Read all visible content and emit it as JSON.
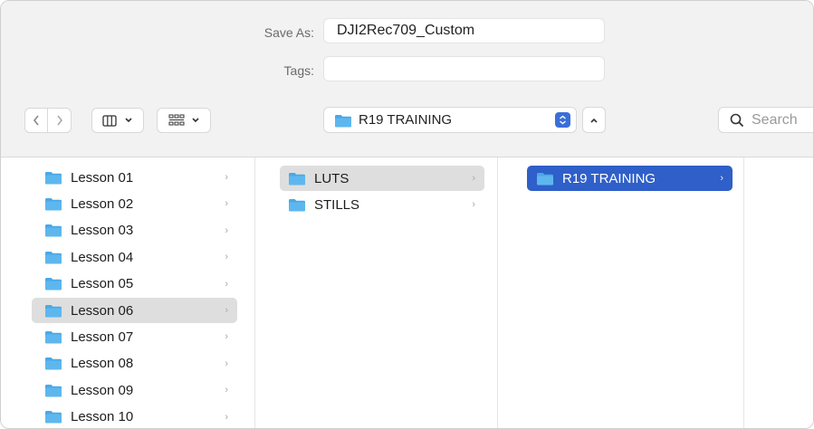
{
  "save_as": {
    "label": "Save As:",
    "value": "DJI2Rec709_Custom"
  },
  "tags": {
    "label": "Tags:",
    "value": ""
  },
  "location": {
    "name": "R19 TRAINING"
  },
  "search": {
    "placeholder": "Search"
  },
  "columns": {
    "col1": [
      {
        "label": "Lesson 01"
      },
      {
        "label": "Lesson 02"
      },
      {
        "label": "Lesson 03"
      },
      {
        "label": "Lesson 04"
      },
      {
        "label": "Lesson 05"
      },
      {
        "label": "Lesson 06",
        "selected": true
      },
      {
        "label": "Lesson 07"
      },
      {
        "label": "Lesson 08"
      },
      {
        "label": "Lesson 09"
      },
      {
        "label": "Lesson 10"
      }
    ],
    "col2": [
      {
        "label": "LUTS",
        "selected": true
      },
      {
        "label": "STILLS"
      }
    ],
    "col3": [
      {
        "label": "R19 TRAINING",
        "selected": true
      }
    ]
  },
  "chevron_glyph": "›",
  "colors": {
    "accent": "#2f5fc8",
    "folder": "#4aa8e6",
    "toolbar_bg": "#f2f2f2"
  }
}
